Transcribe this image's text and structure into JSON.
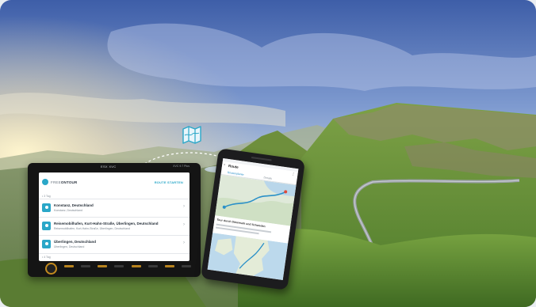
{
  "colors": {
    "accent": "#2aa7c8",
    "sky_top": "#4f6fb8",
    "grass": "#6f9a3a"
  },
  "head_unit": {
    "brand": "ESX XVC",
    "model": "XVC 9.7 Plus",
    "app_name_prefix": "FREE",
    "app_name_bold": "ONTOUR",
    "action_label": "ROUTE STARTEN",
    "section_top": "• 3 Tag",
    "section_bottom": "• 4 Tag",
    "rows": [
      {
        "title": "Konstanz, Deutschland",
        "subtitle": "Konstanz, Deutschland",
        "icon": "map-pin-icon"
      },
      {
        "title": "Reisemobilhafen, Kurt-Hahn-Straße, Überlingen, Deutschland",
        "subtitle": "Reisemobilhafen, Kurt-Hahn-Straße, Überlingen, Deutschland",
        "icon": "map-pin-icon"
      },
      {
        "title": "Überlingen, Deutschland",
        "subtitle": "Überlingen, Deutschland",
        "icon": "map-pin-icon"
      }
    ]
  },
  "phone": {
    "app_title": "Route",
    "tab_1": "Routenplaner",
    "tab_2": "Details",
    "info_title": "Tour durch Dänemark und Schweden"
  },
  "floating_icon": "folded-map-icon"
}
